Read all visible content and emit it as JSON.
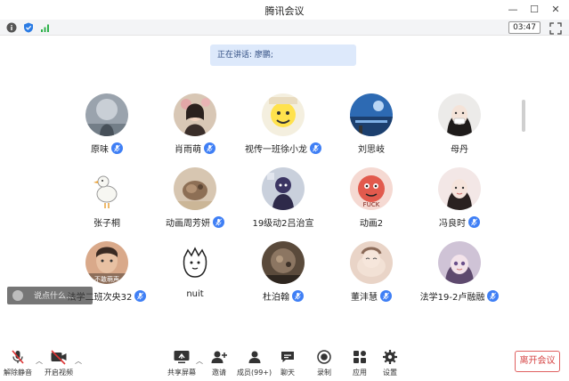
{
  "window": {
    "title": "腾讯会议"
  },
  "infobar": {
    "timer": "03:47"
  },
  "speaking": {
    "label": "正在讲话: 廖鹏;"
  },
  "participants": [
    {
      "name": "原味",
      "mic": true
    },
    {
      "name": "肖雨萌",
      "mic": true
    },
    {
      "name": "视传一班徐小龙",
      "mic": true
    },
    {
      "name": "刘思岐",
      "mic": false
    },
    {
      "name": "母丹",
      "mic": false
    },
    {
      "name": "张子桐",
      "mic": false
    },
    {
      "name": "动画周芳妍",
      "mic": true
    },
    {
      "name": "19级动2吕治宣",
      "mic": false
    },
    {
      "name": "动画2",
      "mic": false
    },
    {
      "name": "冯良时",
      "mic": true
    },
    {
      "name": "法学二班次央32",
      "mic": true
    },
    {
      "name": "nuit",
      "mic": false
    },
    {
      "name": "杜泊翰",
      "mic": true
    },
    {
      "name": "董沣慧",
      "mic": true
    },
    {
      "name": "法学19-2卢融融",
      "mic": true
    }
  ],
  "avatar_text": {
    "avatar_10": "不敢萌声"
  },
  "comment": {
    "placeholder": "说点什么..."
  },
  "toolbar": {
    "unmute": "解除静音",
    "start_video": "开启视频",
    "share_screen": "共享屏幕",
    "invite": "邀请",
    "members": "成员(99+)",
    "chat": "聊天",
    "record": "录制",
    "apps": "应用",
    "settings": "设置",
    "leave": "离开会议"
  },
  "colors": {
    "accent": "#3f7ff5",
    "speaking_bg": "#dde9fb",
    "leave_red": "#d64545"
  }
}
